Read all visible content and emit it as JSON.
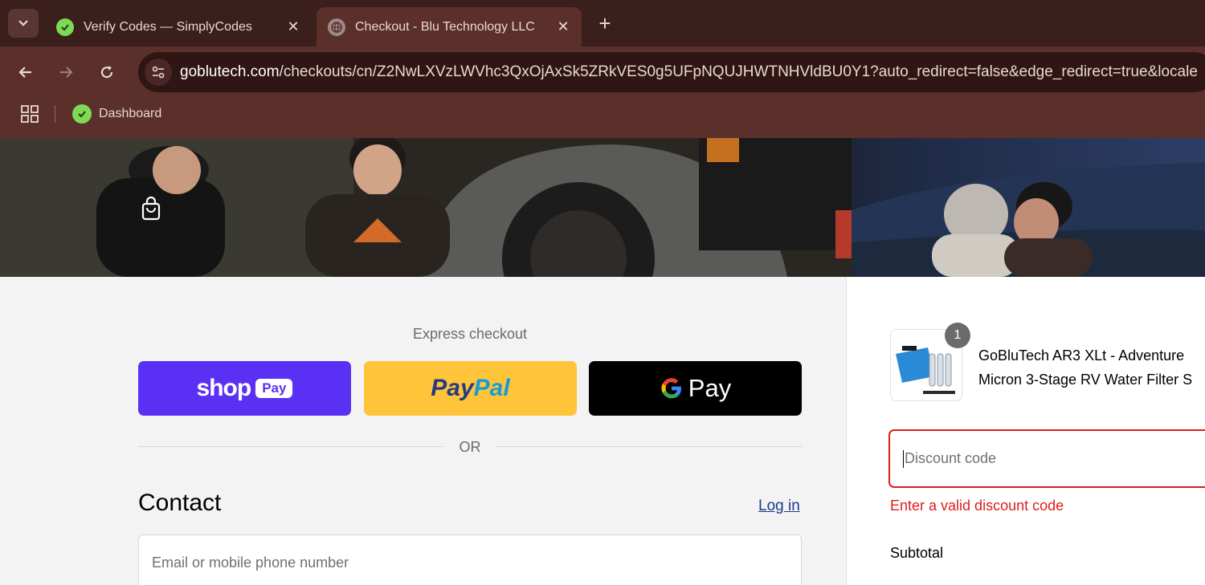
{
  "browser": {
    "tabs": [
      {
        "title": "Verify Codes — SimplyCodes",
        "active": false
      },
      {
        "title": "Checkout - Blu Technology LLC",
        "active": true
      }
    ],
    "new_tab_label": "+",
    "close_label": "✕",
    "url_host": "goblutech.com",
    "url_path": "/checkouts/cn/Z2NwLXVzLWVhc3QxOjAxSk5ZRkVES0g5UFpNQUJHWTNHVldBU0Y1?auto_redirect=false&edge_redirect=true&locale",
    "bookmarks": [
      {
        "label": "Dashboard"
      }
    ]
  },
  "checkout": {
    "express_label": "Express checkout",
    "shop_pay": {
      "word": "shop",
      "pill": "Pay"
    },
    "paypal": {
      "pay": "Pay",
      "pal": "Pal"
    },
    "gpay": {
      "word": "Pay"
    },
    "or_label": "OR",
    "contact_title": "Contact",
    "login_label": "Log in",
    "email_placeholder": "Email or mobile phone number"
  },
  "summary": {
    "quantity": "1",
    "product_line1": "GoBluTech AR3 XLt - Adventure",
    "product_line2": "Micron 3-Stage RV Water Filter S",
    "discount_placeholder": "Discount code",
    "discount_error": "Enter a valid discount code",
    "subtotal_label": "Subtotal"
  },
  "colors": {
    "shop_pay": "#5a31f4",
    "paypal": "#ffc439",
    "gpay": "#000000",
    "error": "#dd1d1d",
    "link": "#1b3a8a"
  }
}
